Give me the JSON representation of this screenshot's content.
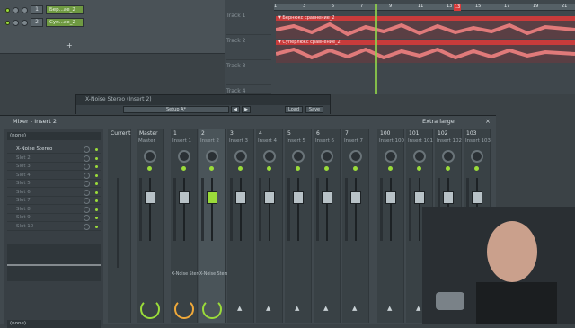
{
  "channel_rack": {
    "rows": [
      {
        "number": "1",
        "name": "Бер...ае_2"
      },
      {
        "number": "2",
        "name": "Суп...ае_2"
      }
    ],
    "add_label": "+"
  },
  "playlist": {
    "ruler_ticks": [
      "1",
      "3",
      "5",
      "7",
      "9",
      "11",
      "13",
      "15",
      "17",
      "19",
      "21"
    ],
    "marker": "13",
    "tracks": [
      "Track 1",
      "Track 2",
      "Track 3",
      "Track 4"
    ],
    "clips": [
      {
        "title": "▼ Бернюкс сравнение_2"
      },
      {
        "title": "▼ Суперлюкс сравнение_2"
      }
    ],
    "accent": "#c83b3b",
    "playhead_color": "#8fd14a"
  },
  "plugin": {
    "title": "X-Noise Stereo (Insert 2)",
    "preset": "Setup A*",
    "buttons": [
      "Load",
      "Save"
    ]
  },
  "mixer": {
    "title": "Mixer - Insert 2",
    "size_label": "Extra large",
    "close_icon": "×",
    "preset_select": "(none)",
    "output_select": "(none)",
    "slots": [
      "X-Noise Stereo",
      "Slot 2",
      "Slot 3",
      "Slot 4",
      "Slot 5",
      "Slot 6",
      "Slot 7",
      "Slot 8",
      "Slot 9",
      "Slot 10"
    ],
    "strips": [
      {
        "num": "Current",
        "name": ""
      },
      {
        "num": "Master",
        "name": "Master"
      },
      {
        "num": "1",
        "name": "Insert 1",
        "fx": "X-Noise Stereo"
      },
      {
        "num": "2",
        "name": "Insert 2",
        "fx": "X-Noise Stereo"
      },
      {
        "num": "3",
        "name": "Insert 3"
      },
      {
        "num": "4",
        "name": "Insert 4"
      },
      {
        "num": "5",
        "name": "Insert 5"
      },
      {
        "num": "6",
        "name": "Insert 6"
      },
      {
        "num": "7",
        "name": "Insert 7"
      },
      {
        "num": "100",
        "name": "Insert 100"
      },
      {
        "num": "101",
        "name": "Insert 101"
      },
      {
        "num": "102",
        "name": "Insert 102"
      },
      {
        "num": "103",
        "name": "Insert 103"
      }
    ],
    "green": "#9bdc3a"
  }
}
